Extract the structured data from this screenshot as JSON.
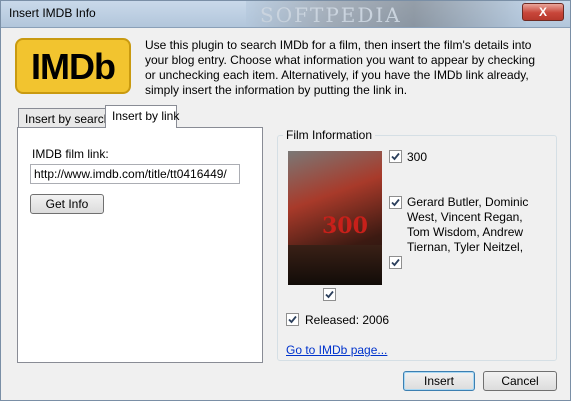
{
  "window": {
    "title": "Insert IMDB Info",
    "close_label": "X",
    "banner_text": "SOFTPEDIA"
  },
  "logo": {
    "text": "IMDb"
  },
  "intro": "Use this plugin to search IMDb for a film, then insert the film's details into your blog entry. Choose what information you want to appear by checking or unchecking each item. Alternatively, if you have the IMDb link already, simply insert the information by putting the link in.",
  "tabs": [
    {
      "label": "Insert by search",
      "active": false
    },
    {
      "label": "Insert by link",
      "active": true
    }
  ],
  "link_tab": {
    "field_label": "IMDB film link:",
    "field_value": "http://www.imdb.com/title/tt0416449/",
    "get_info_label": "Get Info"
  },
  "film_info": {
    "legend": "Film Information",
    "title": "300",
    "cast": "Gerard Butler, Dominic West, Vincent Regan, Tom Wisdom, Andrew Tiernan, Tyler Neitzel,",
    "poster_text": "300",
    "released": "Released: 2006",
    "link_text": "Go to IMDb page...",
    "title_checked": true,
    "cast_checked": true,
    "extra_checked": true,
    "poster_checked": true,
    "released_checked": true
  },
  "buttons": {
    "insert": "Insert",
    "cancel": "Cancel"
  },
  "colors": {
    "accent": "#f2c42f",
    "link": "#0033cc",
    "default_button_border": "#3c7fb1"
  }
}
